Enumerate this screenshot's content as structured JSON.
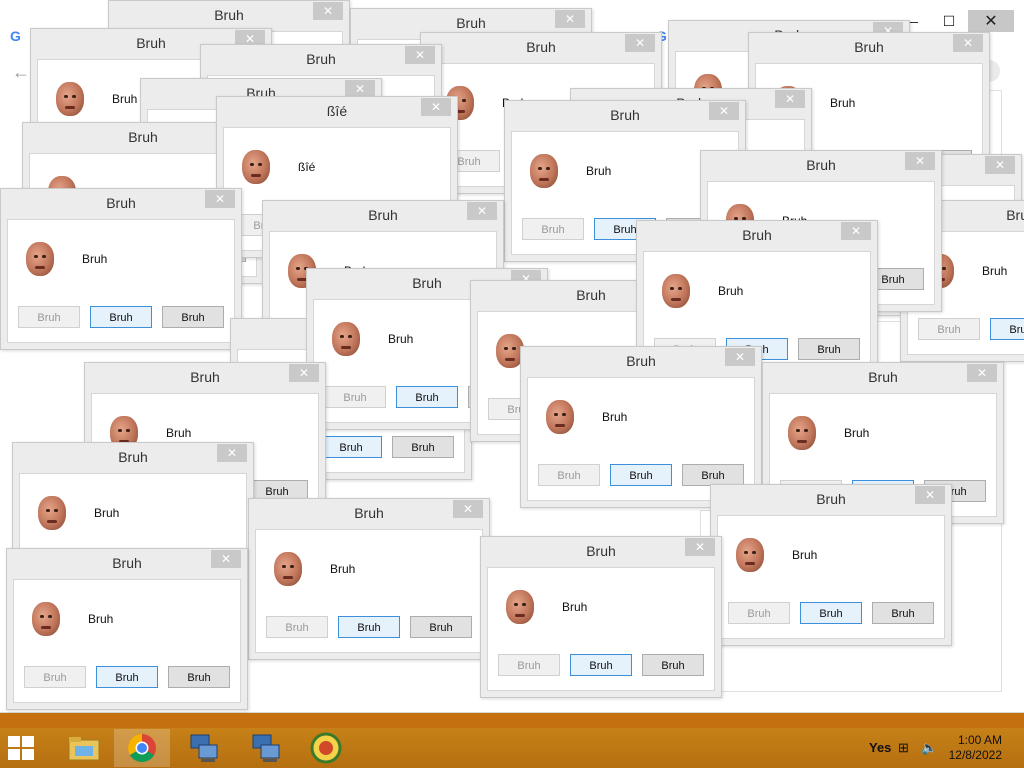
{
  "dialog": {
    "title": "Bruh",
    "message": "Bruh",
    "button_1": "Bruh",
    "button_2": "Bruh",
    "button_3": "Bruh",
    "close_glyph": "✕"
  },
  "glitch_dialog": {
    "title": "ßîé",
    "message": "ßîé",
    "button_1": "Bruh",
    "button_2": "Bruh",
    "button_3": "Bruh"
  },
  "browser": {
    "tab_logo": "G",
    "minimize": "—",
    "maximize": "☐",
    "close": "✕"
  },
  "taskbar": {
    "apps": [
      {
        "name": "file-explorer",
        "icon": "folder-icon"
      },
      {
        "name": "chrome",
        "icon": "chrome-icon"
      },
      {
        "name": "network-app-1",
        "icon": "network-computer-icon"
      },
      {
        "name": "network-app-2",
        "icon": "network-computer-icon"
      },
      {
        "name": "badge-app",
        "icon": "badge-icon"
      }
    ],
    "tray_label": "Yes",
    "time": "1:00 AM",
    "date": "12/8/2022"
  },
  "colors": {
    "taskbar": "#b9741a",
    "focus_border": "#3c8fd8",
    "dialog_frame": "#ececec"
  }
}
